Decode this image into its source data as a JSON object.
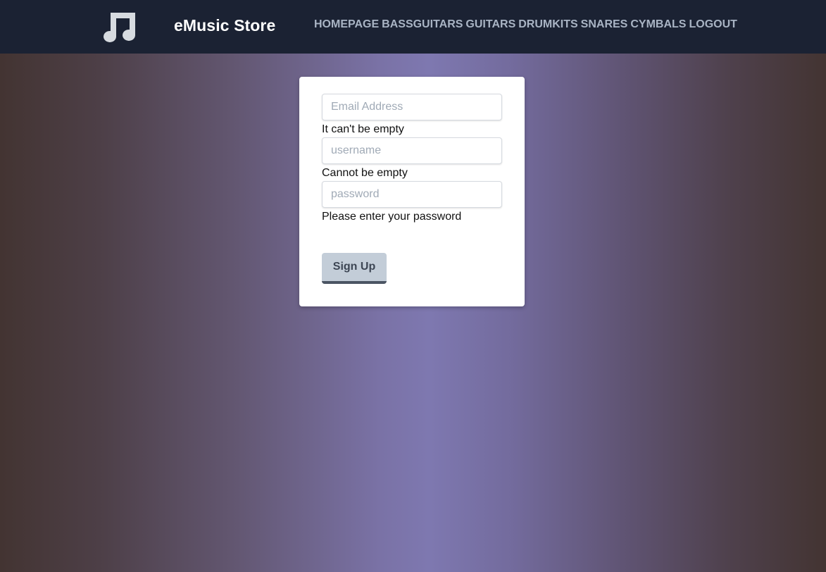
{
  "header": {
    "brand": "eMusic Store",
    "logo_icon": "music-note-icon",
    "nav": [
      "HOMEPAGE",
      "BASSGUITARS",
      "GUITARS",
      "DRUMKITS",
      "SNARES",
      "CYMBALS",
      "LOGOUT"
    ]
  },
  "form": {
    "email": {
      "placeholder": "Email Address",
      "value": "",
      "hint": "It can't be empty"
    },
    "username": {
      "placeholder": "username",
      "value": "",
      "hint": "Cannot be empty"
    },
    "password": {
      "placeholder": "password",
      "value": "",
      "hint": "Please enter your password"
    },
    "submit_label": "Sign Up"
  },
  "colors": {
    "navbar": "#1b2233",
    "nav_link": "#a9b4c4",
    "button_bg": "#c3cdd8",
    "button_border": "#4b5563"
  }
}
